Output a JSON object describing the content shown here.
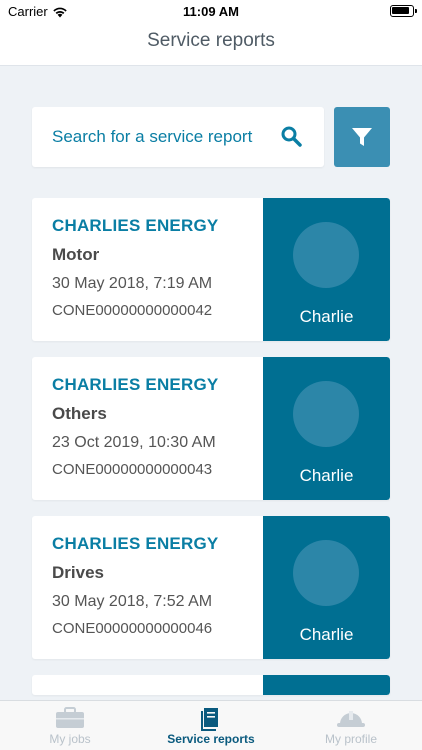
{
  "status_bar": {
    "carrier": "Carrier",
    "time": "11:09 AM"
  },
  "header": {
    "title": "Service reports"
  },
  "search": {
    "placeholder": "Search for a service report"
  },
  "reports": [
    {
      "company": "CHARLIES ENERGY",
      "category": "Motor",
      "date": "30 May 2018, 7:19 AM",
      "reference": "CONE00000000000042",
      "engineer": "Charlie"
    },
    {
      "company": "CHARLIES ENERGY",
      "category": "Others",
      "date": "23 Oct 2019, 10:30 AM",
      "reference": "CONE00000000000043",
      "engineer": "Charlie"
    },
    {
      "company": "CHARLIES ENERGY",
      "category": "Drives",
      "date": "30 May 2018, 7:52 AM",
      "reference": "CONE00000000000046",
      "engineer": "Charlie"
    }
  ],
  "tabs": [
    {
      "label": "My jobs",
      "icon": "briefcase-icon",
      "active": false
    },
    {
      "label": "Service reports",
      "icon": "document-icon",
      "active": true
    },
    {
      "label": "My profile",
      "icon": "hard-hat-icon",
      "active": false
    }
  ],
  "colors": {
    "accent": "#0a7ea4",
    "card_side": "#006f92",
    "filter_button": "#3b8fb3",
    "background": "#eef2f6"
  }
}
